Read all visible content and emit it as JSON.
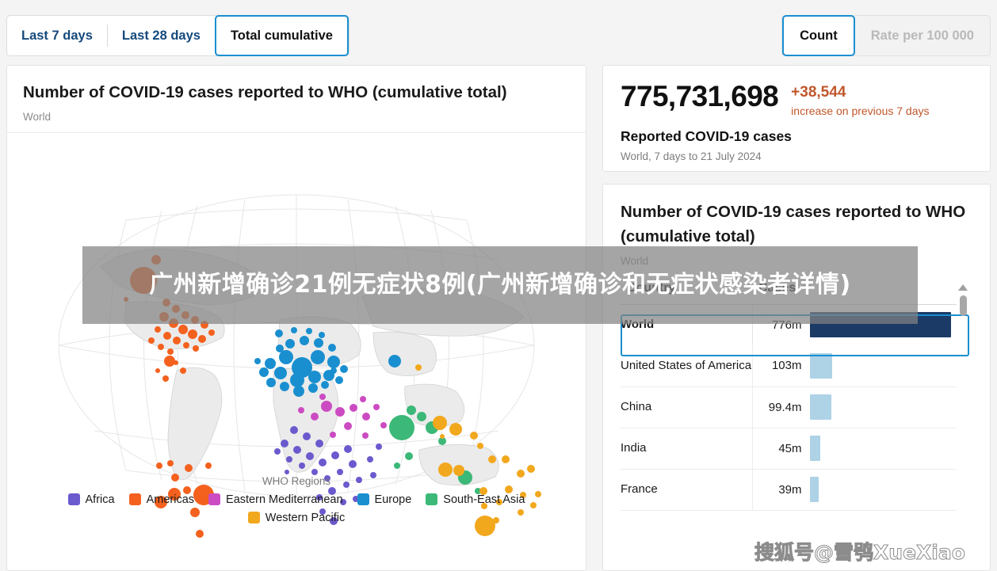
{
  "toolbar": {
    "tabs": [
      {
        "label": "Last 7 days",
        "active": false
      },
      {
        "label": "Last 28 days",
        "active": false
      },
      {
        "label": "Total cumulative",
        "active": true
      }
    ],
    "measure_toggle": [
      {
        "label": "Count",
        "active": true
      },
      {
        "label": "Rate per 100 000",
        "active": false
      }
    ]
  },
  "map_card": {
    "title": "Number of COVID-19 cases reported to WHO (cumulative total)",
    "subtitle": "World",
    "legend": {
      "title": "WHO Regions",
      "items": [
        {
          "label": "Africa",
          "color": "#6a5acd"
        },
        {
          "label": "Americas",
          "color": "#f4611e"
        },
        {
          "label": "Eastern Mediterranean",
          "color": "#cc4bc2"
        },
        {
          "label": "Europe",
          "color": "#1a8fd0"
        },
        {
          "label": "South-East Asia",
          "color": "#3cb878"
        },
        {
          "label": "Western Pacific",
          "color": "#f2a81d"
        }
      ]
    }
  },
  "stat_card": {
    "value": "775,731,698",
    "delta_value": "+38,544",
    "delta_caption": "increase on previous 7 days",
    "label": "Reported COVID-19 cases",
    "period": "World, 7 days to 21 July 2024",
    "delta_color": "#c0572b"
  },
  "table_card": {
    "title": "Number of COVID-19 cases reported to WHO (cumulative total)",
    "subtitle": "World",
    "columns": [
      "Country",
      "Cases"
    ],
    "sort_column": "Cases",
    "sort_direction": "descending",
    "rows": [
      {
        "country": "World",
        "cases": "776m",
        "bar_pct": 100,
        "selected": true
      },
      {
        "country": "United States of America",
        "cases": "103m",
        "bar_pct": 13.3,
        "selected": false
      },
      {
        "country": "China",
        "cases": "99.4m",
        "bar_pct": 12.8,
        "selected": false
      },
      {
        "country": "India",
        "cases": "45m",
        "bar_pct": 5.8,
        "selected": false
      },
      {
        "country": "France",
        "cases": "39m",
        "bar_pct": 5.0,
        "selected": false
      }
    ],
    "bar_color_selected": "#1b3a66",
    "bar_color": "#aed2e6"
  },
  "overlay": {
    "banner_text": "广州新增确诊21例无症状8例(广州新增确诊和无症状感染者详情)",
    "watermark": "搜狐号@雪鸮XueXiao"
  },
  "chart_data": {
    "type": "bar",
    "title": "Number of COVID-19 cases reported to WHO (cumulative total)",
    "subtitle": "World",
    "xlabel": "Cases",
    "ylabel": "Country",
    "categories": [
      "World",
      "United States of America",
      "China",
      "India",
      "France"
    ],
    "values": [
      776000000,
      103000000,
      99400000,
      45000000,
      39000000
    ],
    "value_labels": [
      "776m",
      "103m",
      "99.4m",
      "45m",
      "39m"
    ],
    "grid": false,
    "legend": "none",
    "notes": "Horizontal bar table sorted descending by Cases; World row highlighted."
  },
  "map_data": {
    "type": "bubble-map",
    "title": "Number of COVID-19 cases reported to WHO (cumulative total)",
    "series_by_region": [
      "Africa",
      "Americas",
      "Eastern Mediterranean",
      "Europe",
      "South-East Asia",
      "Western Pacific"
    ]
  }
}
